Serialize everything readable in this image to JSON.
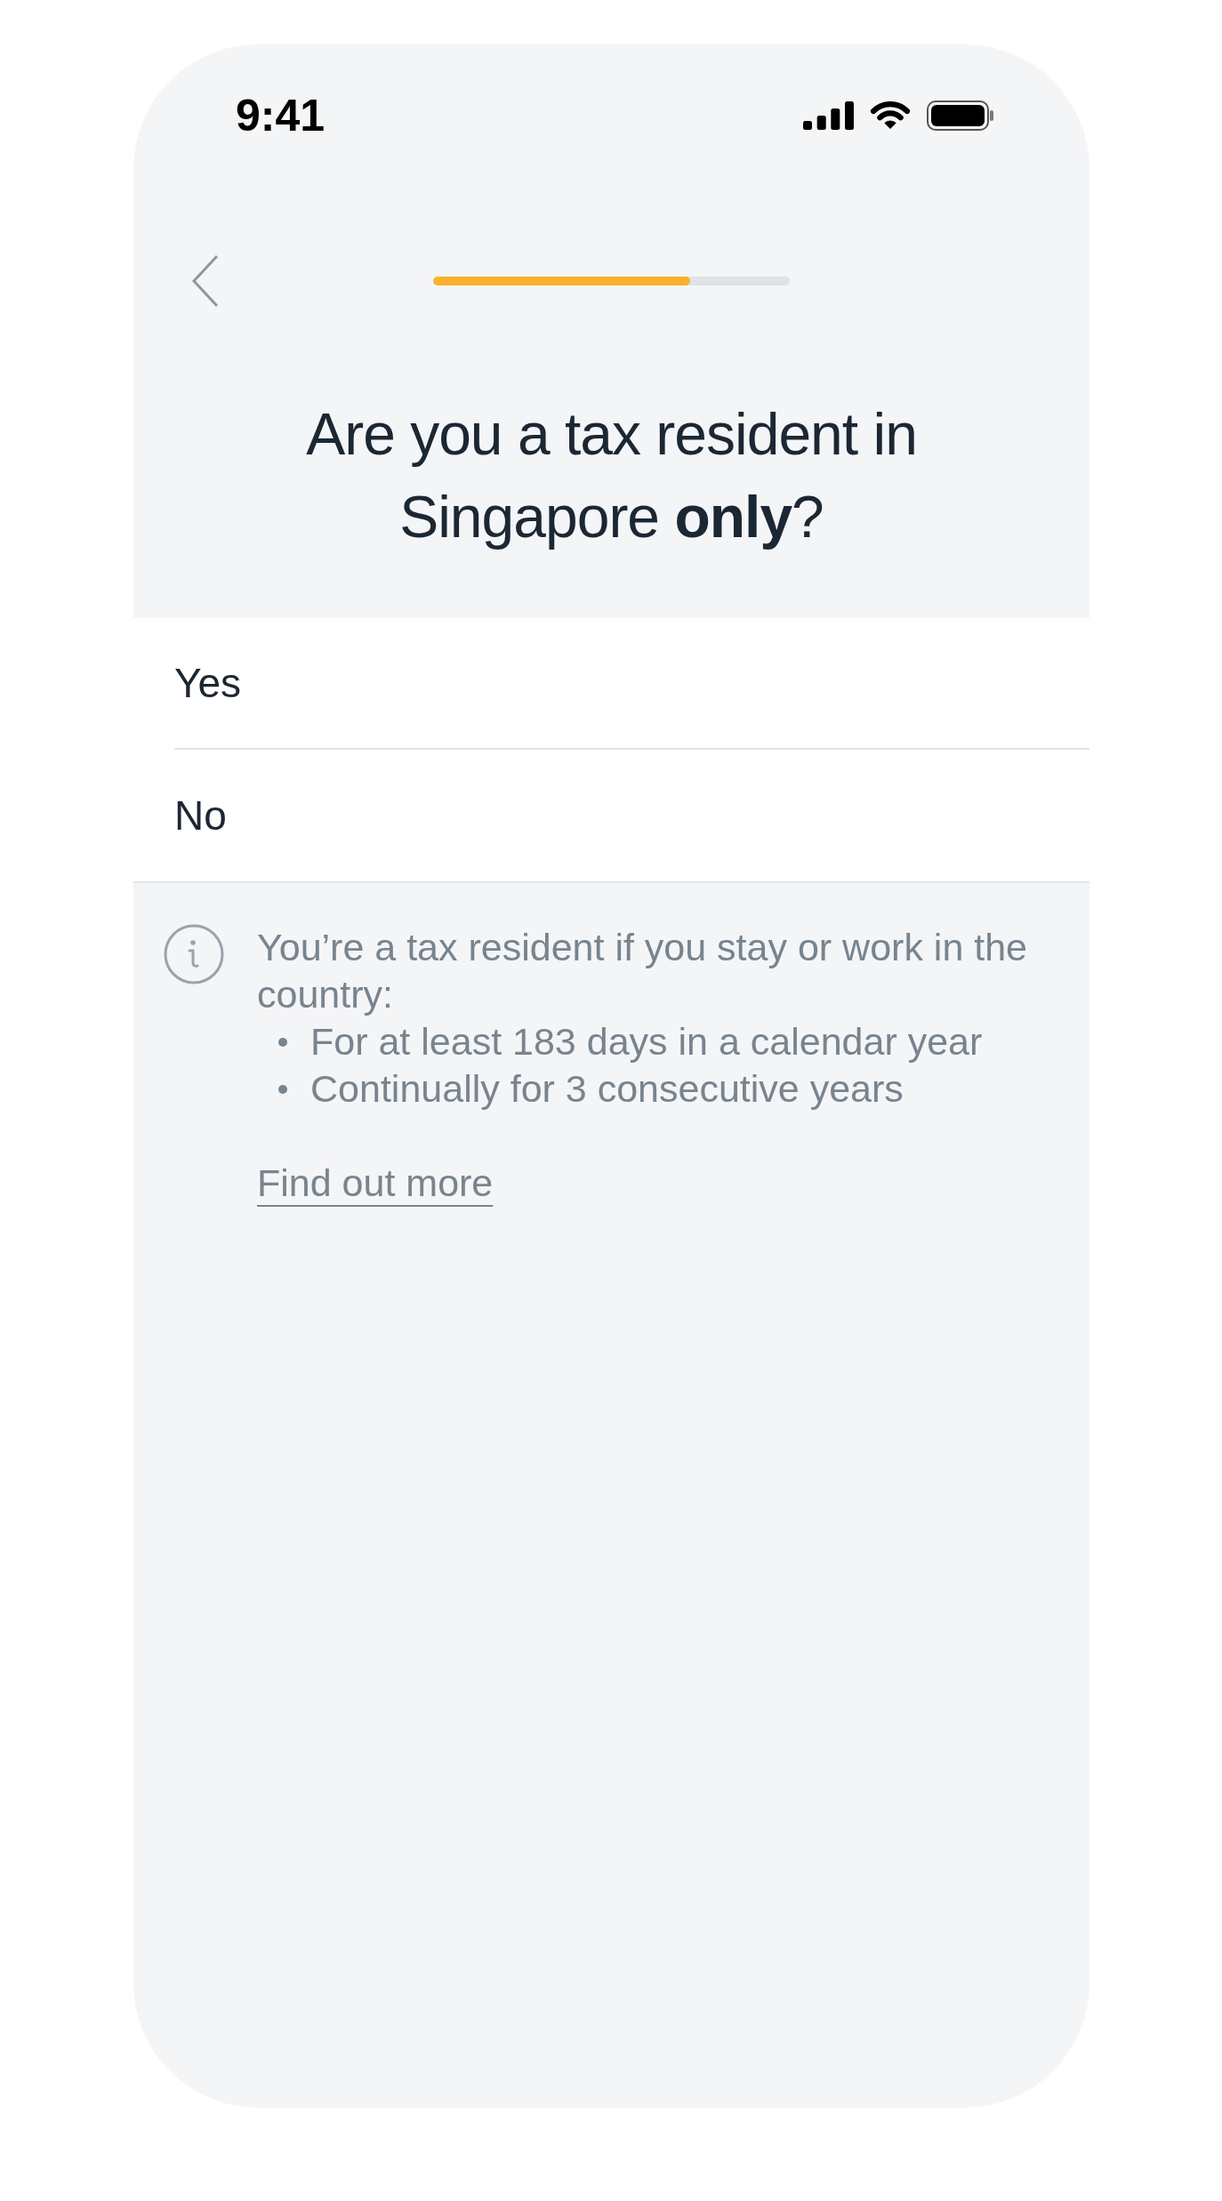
{
  "status_bar": {
    "time": "9:41"
  },
  "header": {
    "progress": {
      "level": 0.72
    },
    "title": "Are you a tax resident in Singapore **only**?"
  },
  "options": [
    {
      "label": "Yes"
    },
    {
      "label": "No"
    }
  ],
  "info": {
    "text": "You’re a tax resident if you stay or work in the country:",
    "bullets": [
      "For at least 183 days in a calendar year",
      "Continually for 3 consecutive years"
    ],
    "link": "Find out more"
  }
}
